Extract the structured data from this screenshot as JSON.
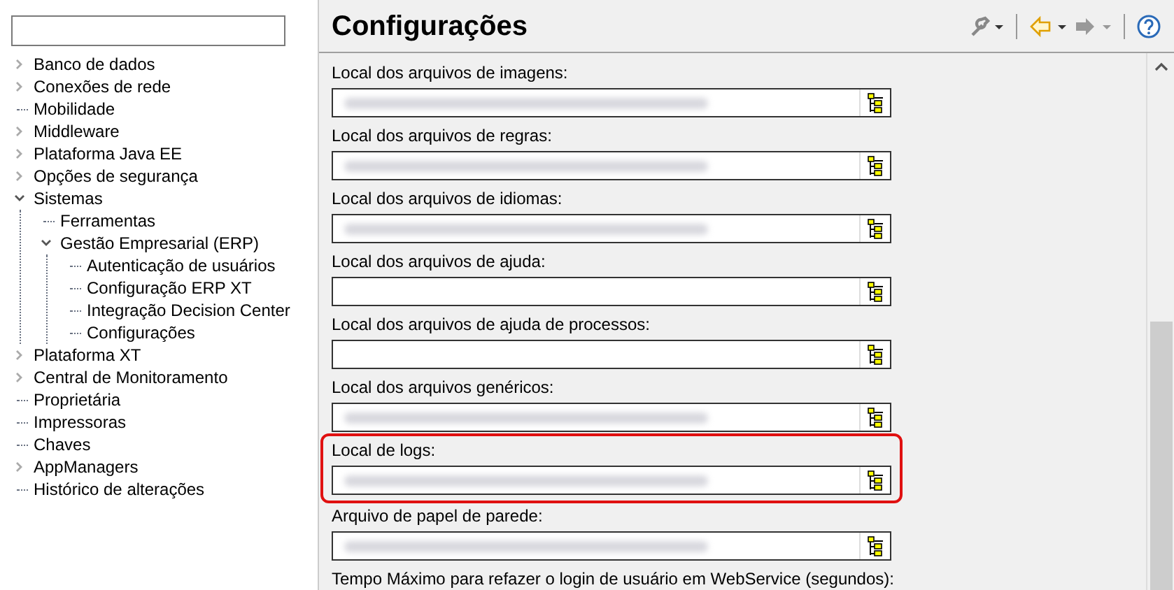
{
  "sidebar": {
    "tree": [
      {
        "label": "Banco de dados",
        "kind": "branch",
        "expanded": false
      },
      {
        "label": "Conexões de rede",
        "kind": "branch",
        "expanded": false
      },
      {
        "label": "Mobilidade",
        "kind": "leaf"
      },
      {
        "label": "Middleware",
        "kind": "branch",
        "expanded": false
      },
      {
        "label": "Plataforma Java EE",
        "kind": "branch",
        "expanded": false
      },
      {
        "label": "Opções de segurança",
        "kind": "branch",
        "expanded": false
      },
      {
        "label": "Sistemas",
        "kind": "branch",
        "expanded": true,
        "children": [
          {
            "label": "Ferramentas",
            "kind": "leaf"
          },
          {
            "label": "Gestão Empresarial (ERP)",
            "kind": "branch",
            "expanded": true,
            "children": [
              {
                "label": "Autenticação de usuários",
                "kind": "leaf"
              },
              {
                "label": "Configuração ERP XT",
                "kind": "leaf"
              },
              {
                "label": "Integração Decision Center",
                "kind": "leaf"
              },
              {
                "label": "Configurações",
                "kind": "leaf"
              }
            ]
          }
        ]
      },
      {
        "label": "Plataforma XT",
        "kind": "branch",
        "expanded": false
      },
      {
        "label": "Central de Monitoramento",
        "kind": "branch",
        "expanded": false
      },
      {
        "label": "Proprietária",
        "kind": "leaf"
      },
      {
        "label": "Impressoras",
        "kind": "leaf"
      },
      {
        "label": "Chaves",
        "kind": "leaf"
      },
      {
        "label": "AppManagers",
        "kind": "branch",
        "expanded": false
      },
      {
        "label": "Histórico de alterações",
        "kind": "leaf"
      }
    ]
  },
  "panel": {
    "title": "Configurações",
    "fields": [
      {
        "label": "Local dos arquivos de imagens:",
        "blurred": true,
        "highlighted": false
      },
      {
        "label": "Local dos arquivos de regras:",
        "blurred": true,
        "highlighted": false
      },
      {
        "label": "Local dos arquivos de idiomas:",
        "blurred": true,
        "highlighted": false
      },
      {
        "label": "Local dos arquivos de ajuda:",
        "blurred": false,
        "highlighted": false
      },
      {
        "label": "Local dos arquivos de ajuda de processos:",
        "blurred": false,
        "highlighted": false
      },
      {
        "label": "Local dos arquivos genéricos:",
        "blurred": true,
        "highlighted": false
      },
      {
        "label": "Local de logs:",
        "blurred": true,
        "highlighted": true
      },
      {
        "label": "Arquivo de papel de parede:",
        "blurred": true,
        "highlighted": false
      },
      {
        "label": "Tempo Máximo para refazer o login de usuário em WebService (segundos):",
        "highlighted": false
      }
    ]
  }
}
